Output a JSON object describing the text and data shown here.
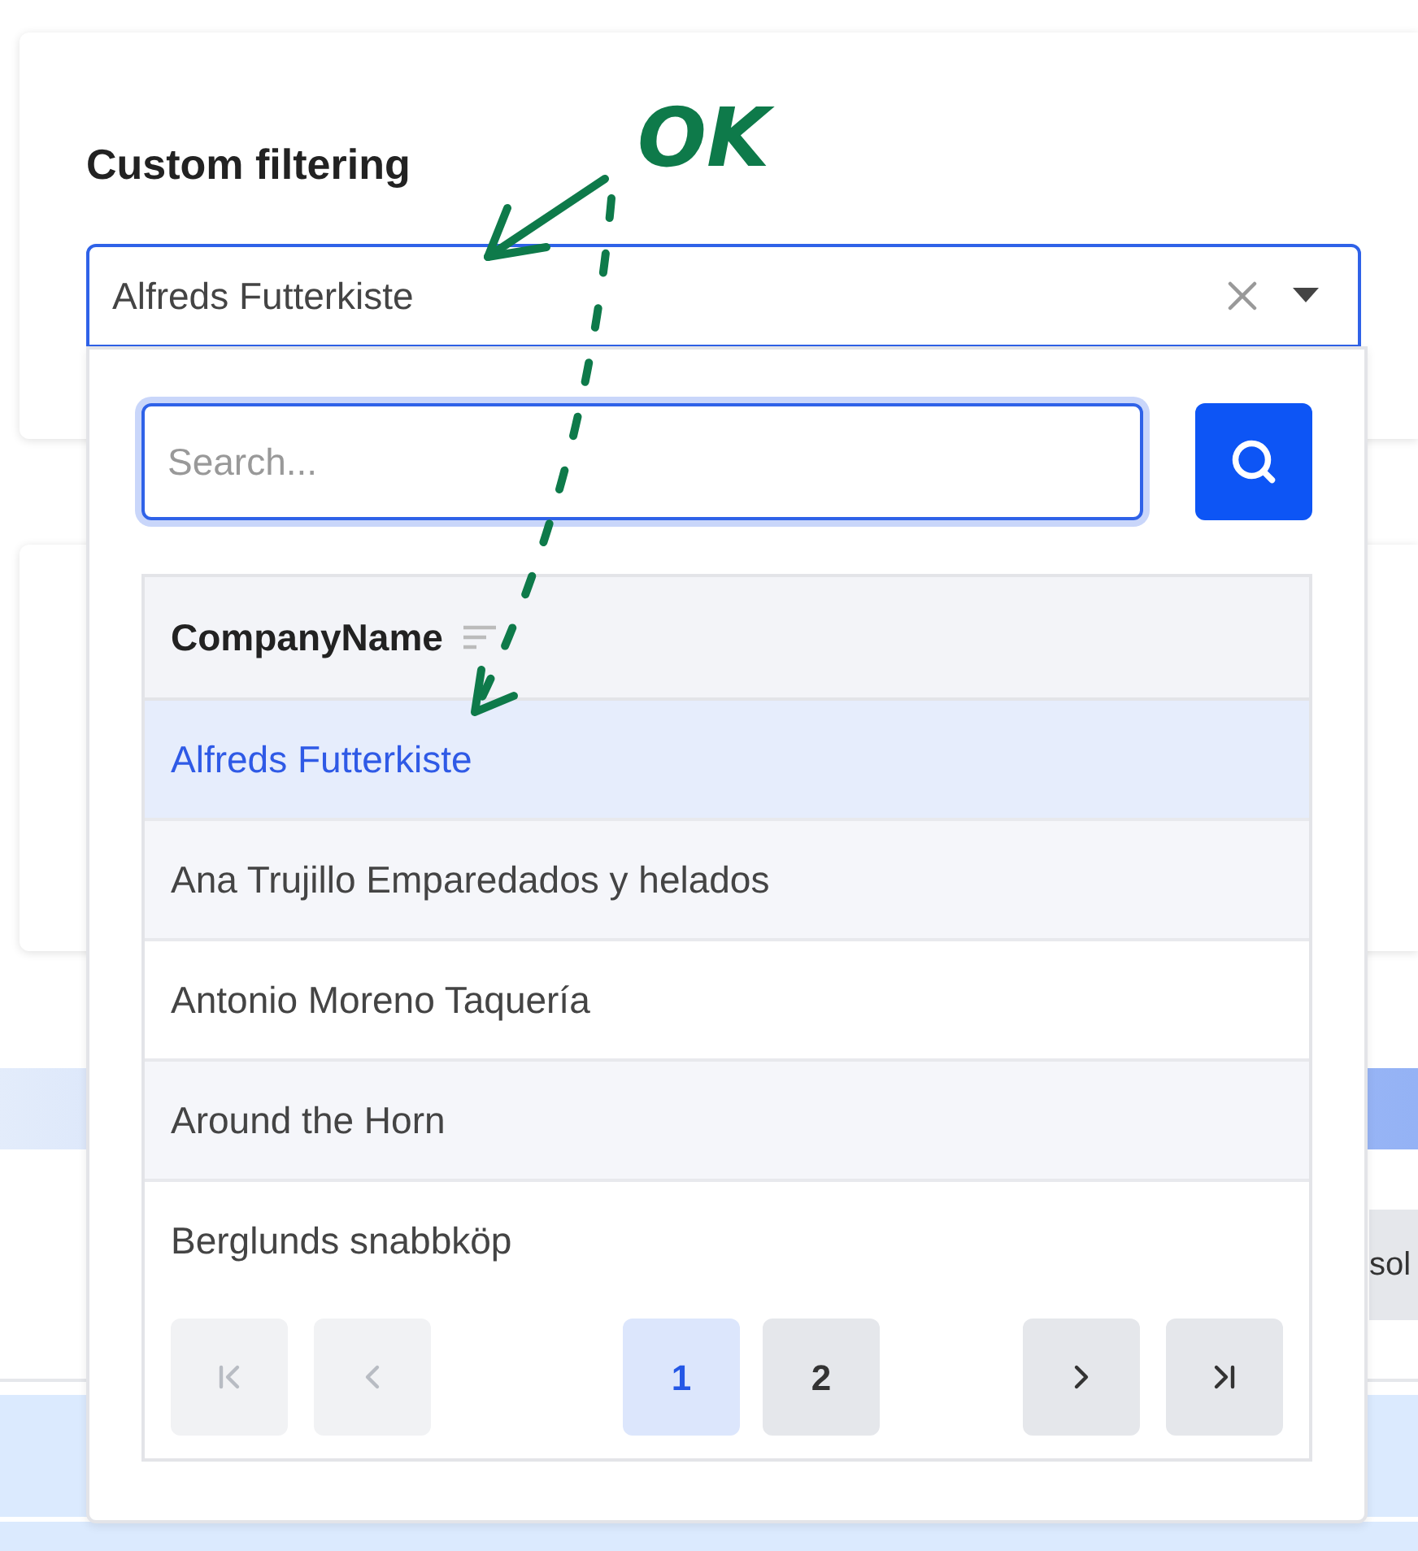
{
  "card": {
    "title": "Custom filtering"
  },
  "select": {
    "value": "Alfreds Futterkiste"
  },
  "dropdown": {
    "search": {
      "placeholder": "Search..."
    },
    "table": {
      "columns": [
        "CompanyName"
      ],
      "rows": [
        {
          "name": "Alfreds Futterkiste",
          "selected": true
        },
        {
          "name": "Ana Trujillo Emparedados y helados",
          "selected": false
        },
        {
          "name": "Antonio Moreno Taquería",
          "selected": false
        },
        {
          "name": "Around the Horn",
          "selected": false
        },
        {
          "name": "Berglunds snabbköp",
          "selected": false
        }
      ]
    },
    "pagination": [
      {
        "kind": "first",
        "disabled": true
      },
      {
        "kind": "prev",
        "disabled": true
      },
      {
        "kind": "page",
        "label": "1",
        "selected": true
      },
      {
        "kind": "page",
        "label": "2",
        "selected": false
      },
      {
        "kind": "next",
        "disabled": false
      },
      {
        "kind": "last",
        "disabled": false
      }
    ]
  },
  "background_button": {
    "label": "sol"
  },
  "annotation": {
    "label": "OK"
  }
}
